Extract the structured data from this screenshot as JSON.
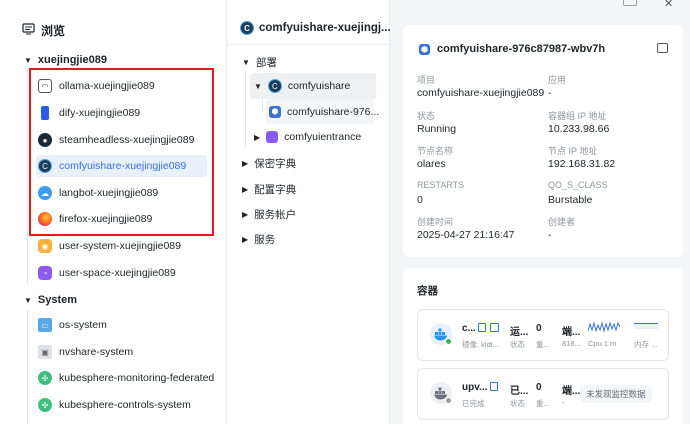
{
  "left": {
    "header": "浏览",
    "group1": "xuejingjie089",
    "group1_items": [
      {
        "label": "ollama-xuejingjie089"
      },
      {
        "label": "dify-xuejingjie089"
      },
      {
        "label": "steamheadless-xuejingjie089"
      },
      {
        "label": "comfyuishare-xuejingjie089"
      },
      {
        "label": "langbot-xuejingjie089"
      },
      {
        "label": "firefox-xuejingjie089"
      },
      {
        "label": "user-system-xuejingjie089"
      },
      {
        "label": "user-space-xuejingjie089"
      }
    ],
    "group2": "System",
    "group2_items": [
      {
        "label": "os-system"
      },
      {
        "label": "nvshare-system"
      },
      {
        "label": "kubesphere-monitoring-federated"
      },
      {
        "label": "kubesphere-controls-system"
      }
    ]
  },
  "middle": {
    "title": "comfyuishare-xuejingj...",
    "deploy": "部署",
    "deploy_items": [
      "comfyuishare",
      "comfyuishare-976...",
      "comfyuientrance"
    ],
    "sections": [
      "保密字典",
      "配置字典",
      "服务帐户",
      "服务"
    ]
  },
  "pod": {
    "title": "comfyuishare-976c87987-wbv7h",
    "fields": [
      {
        "label": "项目",
        "value": "comfyuishare-xuejingjie089"
      },
      {
        "label": "应用",
        "value": "-"
      },
      {
        "label": "状态",
        "value": "Running"
      },
      {
        "label": "容器组 IP 地址",
        "value": "10.233.98.66"
      },
      {
        "label": "节点名称",
        "value": "olares"
      },
      {
        "label": "节点 IP 地址",
        "value": "192.168.31.82"
      },
      {
        "label": "RESTARTS",
        "value": "0"
      },
      {
        "label": "QO_S_CLASS",
        "value": "Burstable"
      },
      {
        "label": "创建时间",
        "value": "2025-04-27 21:16:47"
      },
      {
        "label": "创建者",
        "value": "-"
      }
    ]
  },
  "containers": {
    "title": "容器",
    "items": [
      {
        "name": "c...",
        "status": "运...",
        "status_sub": "状态",
        "restarts": "0",
        "restarts_sub": "重...",
        "port": "端...",
        "port_sub": "818...",
        "image_sub": "镜像: kldt...",
        "cpu_sub": "Cpu 1 m",
        "mem_sub": "内存 ...",
        "dot_color": "#35b35a"
      },
      {
        "name": "upv...",
        "status": "已...",
        "status_sub": "状态",
        "restarts": "0",
        "restarts_sub": "重...",
        "port": "端...",
        "port_sub": "-",
        "image_sub": "已完成",
        "no_monitor": "未发现监控数据",
        "dot_color": "#9aa0a8"
      }
    ]
  },
  "colors": {
    "accent": "#3b72d9",
    "highlight_box": "#e11b1b"
  }
}
